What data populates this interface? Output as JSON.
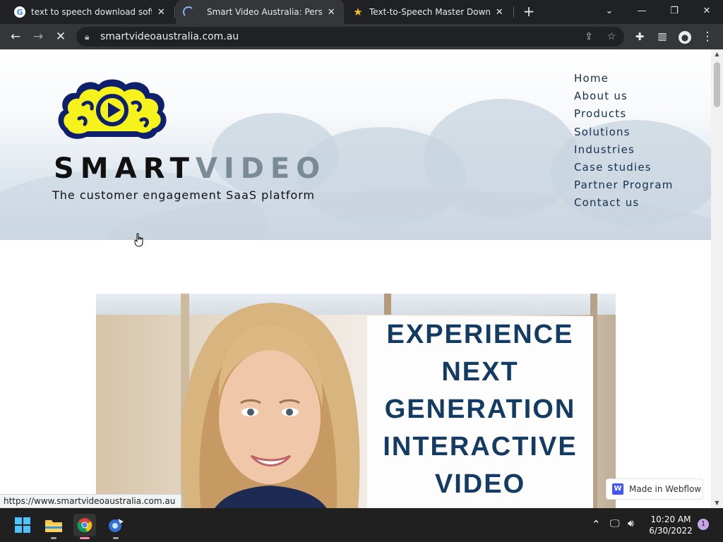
{
  "tabs": [
    {
      "title": "text to speech download softwar",
      "favicon": "google-icon",
      "active": false
    },
    {
      "title": "Smart Video Australia: Personalis",
      "favicon": "loading-spinner-icon",
      "active": true
    },
    {
      "title": "Text-to-Speech Master Downloac",
      "favicon": "star-icon",
      "active": false
    }
  ],
  "window": {
    "new_tab": "+",
    "minimize": "—",
    "restore": "❐",
    "close": "✕",
    "tab_search": "⌄"
  },
  "address_bar": {
    "url": "smartvideoaustralia.com.au"
  },
  "site": {
    "brand_part1": "SMART",
    "brand_part2": "VIDEO",
    "tagline": "The customer engagement SaaS platform",
    "nav": [
      "Home",
      "About us",
      "Products",
      "Solutions",
      "Industries",
      "Case studies",
      "Partner Program",
      "Contact us"
    ],
    "hero_lines": [
      "EXPERIENCE",
      "NEXT",
      "GENERATION",
      "INTERACTIVE",
      "VIDEO"
    ],
    "badge": "Made in Webflow",
    "badge_logo": "W"
  },
  "status_bar": {
    "hover_url": "https://www.smartvideoaustralia.com.au"
  },
  "taskbar": {
    "time": "10:20 AM",
    "date": "6/30/2022",
    "notification_count": "1"
  },
  "colors": {
    "brand_navy": "#143b63",
    "brain_yellow": "#f6f31c",
    "brain_navy": "#0e1f6e",
    "brand_gray": "#7b8b96"
  }
}
